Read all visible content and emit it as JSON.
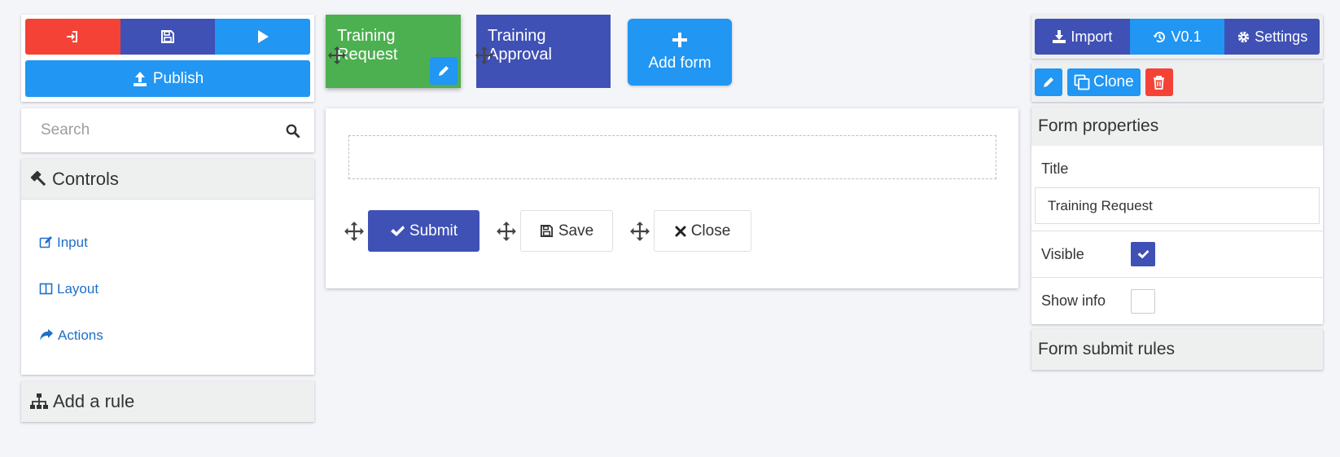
{
  "toolbar": {
    "exit_icon": "sign-in-icon",
    "save_icon": "floppy-disk-icon",
    "play_icon": "play-icon",
    "publish_label": "Publish",
    "publish_icon": "upload-icon"
  },
  "search": {
    "placeholder": "Search",
    "value": "",
    "icon": "search-icon"
  },
  "controls": {
    "title": "Controls",
    "icon": "gavel-icon",
    "items": [
      {
        "label": "Input",
        "icon": "edit-icon"
      },
      {
        "label": "Layout",
        "icon": "columns-icon"
      },
      {
        "label": "Actions",
        "icon": "share-icon"
      }
    ]
  },
  "rules": {
    "add_label": "Add a rule",
    "icon": "sitemap-icon"
  },
  "forms": {
    "tabs": [
      {
        "label": "Training Request",
        "color": "#4caf50",
        "active": true
      },
      {
        "label": "Training Approval",
        "color": "#3f51b5",
        "active": false
      }
    ],
    "add_label": "Add form"
  },
  "canvas": {
    "buttons": [
      {
        "label": "Submit",
        "icon": "check-icon"
      },
      {
        "label": "Save",
        "icon": "floppy-disk-icon"
      },
      {
        "label": "Close",
        "icon": "times-icon"
      }
    ]
  },
  "right_toolbar": {
    "import_label": "Import",
    "version_label": "V0.1",
    "settings_label": "Settings",
    "clone_label": "Clone"
  },
  "properties": {
    "header": "Form properties",
    "title_label": "Title",
    "title_value": "Training Request",
    "visible_label": "Visible",
    "visible_checked": true,
    "show_info_label": "Show info",
    "show_info_checked": false,
    "submit_rules_label": "Form submit rules"
  },
  "colors": {
    "primary": "#2196f3",
    "indigo": "#3f51b5",
    "danger": "#f44336",
    "success": "#4caf50",
    "background": "#f4f5f9"
  }
}
